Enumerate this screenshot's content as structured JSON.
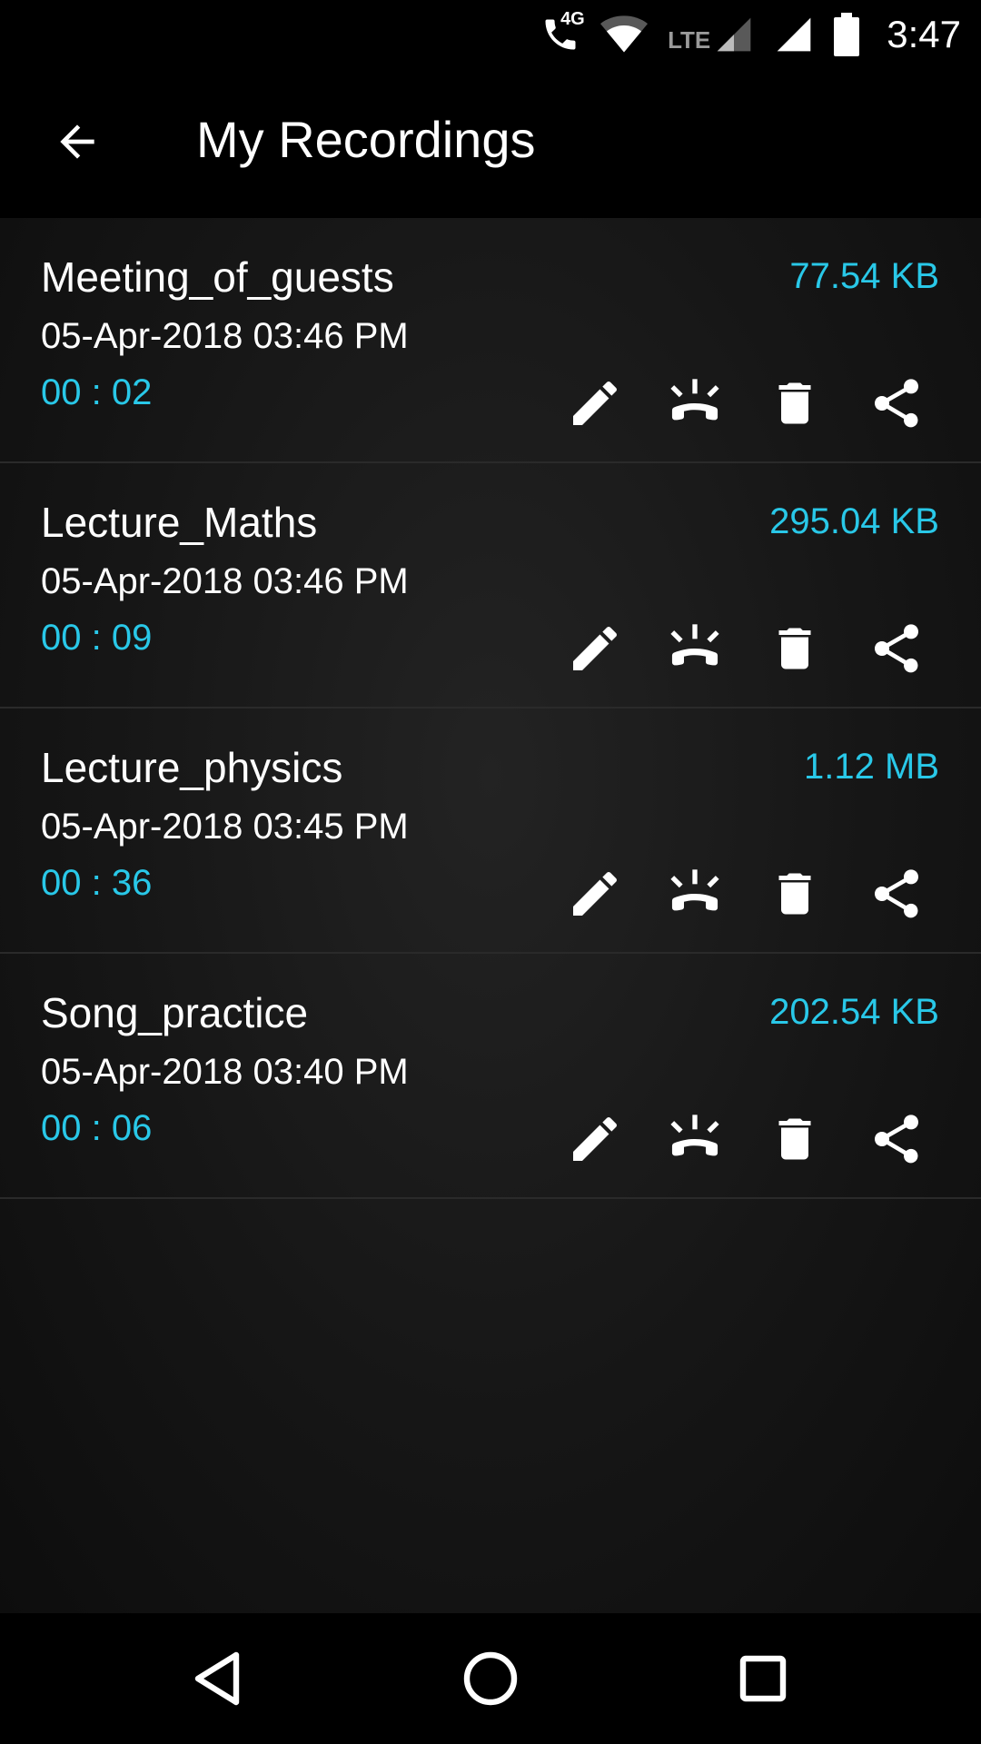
{
  "status_bar": {
    "time": "3:47",
    "network_label": "4G",
    "lte_label": "LTE",
    "icons": [
      "call-4g-icon",
      "wifi-icon",
      "signal-lte-icon",
      "signal-icon",
      "battery-icon"
    ]
  },
  "app_bar": {
    "title": "My Recordings",
    "back_icon": "arrow-back-icon"
  },
  "colors": {
    "accent": "#29c8e8",
    "text_primary": "#ffffff",
    "background": "#000000"
  },
  "recordings": [
    {
      "name": "Meeting_of_guests",
      "date": "05-Apr-2018 03:46 PM",
      "duration": "00 : 02",
      "size": "77.54 KB"
    },
    {
      "name": "Lecture_Maths",
      "date": "05-Apr-2018 03:46 PM",
      "duration": "00 : 09",
      "size": "295.04 KB"
    },
    {
      "name": "Lecture_physics",
      "date": "05-Apr-2018 03:45 PM",
      "duration": "00 : 36",
      "size": "1.12 MB"
    },
    {
      "name": "Song_practice",
      "date": "05-Apr-2018 03:40 PM",
      "duration": "00 : 06",
      "size": "202.54 KB"
    }
  ],
  "row_actions": [
    "edit-icon",
    "ringtone-call-icon",
    "delete-icon",
    "share-icon"
  ],
  "nav_bar": {
    "icons": [
      "nav-back-icon",
      "nav-home-icon",
      "nav-recents-icon"
    ]
  }
}
